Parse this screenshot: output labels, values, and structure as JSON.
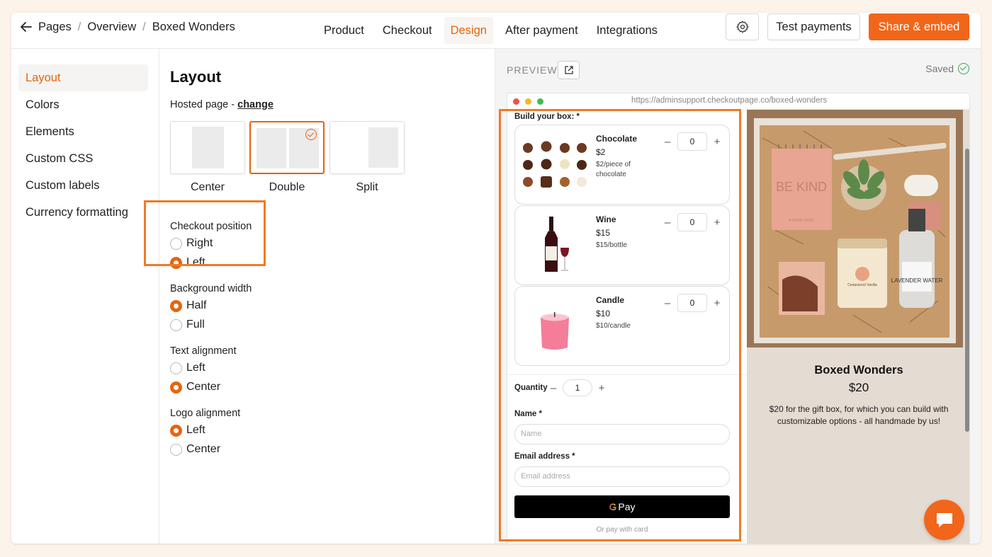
{
  "breadcrumb": [
    "Pages",
    "Overview",
    "Boxed Wonders"
  ],
  "tabs": [
    {
      "label": "Product",
      "active": false
    },
    {
      "label": "Checkout",
      "active": false
    },
    {
      "label": "Design",
      "active": true
    },
    {
      "label": "After payment",
      "active": false
    },
    {
      "label": "Integrations",
      "active": false
    }
  ],
  "header": {
    "test_label": "Test payments",
    "share_label": "Share & embed"
  },
  "sidebar": {
    "items": [
      {
        "label": "Layout",
        "active": true
      },
      {
        "label": "Colors"
      },
      {
        "label": "Elements"
      },
      {
        "label": "Custom CSS"
      },
      {
        "label": "Custom labels"
      },
      {
        "label": "Currency formatting"
      }
    ]
  },
  "panel": {
    "title": "Layout",
    "hosted_prefix": "Hosted page - ",
    "hosted_link": "change",
    "layouts": [
      {
        "label": "Center",
        "selected": false
      },
      {
        "label": "Double",
        "selected": true
      },
      {
        "label": "Split",
        "selected": false
      }
    ],
    "checkout_position": {
      "label": "Checkout position",
      "options": [
        "Right",
        "Left"
      ],
      "selected": "Left"
    },
    "background_width": {
      "label": "Background width",
      "options": [
        "Half",
        "Full"
      ],
      "selected": "Half"
    },
    "text_alignment": {
      "label": "Text alignment",
      "options": [
        "Left",
        "Center"
      ],
      "selected": "Center"
    },
    "logo_alignment": {
      "label": "Logo alignment",
      "options": [
        "Left",
        "Center"
      ],
      "selected": "Left"
    }
  },
  "preview": {
    "label": "PREVIEW",
    "saved": "Saved",
    "url": "https://adminsupport.checkoutpage.co/boxed-wonders",
    "build_label": "Build your box:",
    "items": [
      {
        "name": "Chocolate",
        "price": "$2",
        "unit": "$2/piece of chocolate",
        "qty": "0"
      },
      {
        "name": "Wine",
        "price": "$15",
        "unit": "$15/bottle",
        "qty": "0"
      },
      {
        "name": "Candle",
        "price": "$10",
        "unit": "$10/candle",
        "qty": "0"
      }
    ],
    "quantity_label": "Quantity",
    "quantity_value": "1",
    "name_label": "Name",
    "name_placeholder": "Name",
    "email_label": "Email address",
    "email_placeholder": "Email address",
    "gpay_label": "Pay",
    "or_pay": "Or pay with card",
    "product_title": "Boxed Wonders",
    "product_price": "$20",
    "product_desc": "$20 for the gift box, for which you can build with customizable options - all handmade by us!",
    "photo_texts": {
      "notebook": "BE KIND",
      "notebook_sub": "A WORK HARD",
      "spray": "LAVENDER WATER",
      "tin": "Cedarwood Vanilla"
    }
  },
  "colors": {
    "accent": "#f1661a",
    "highlight": "#f07a25",
    "success": "#3fa64e"
  }
}
